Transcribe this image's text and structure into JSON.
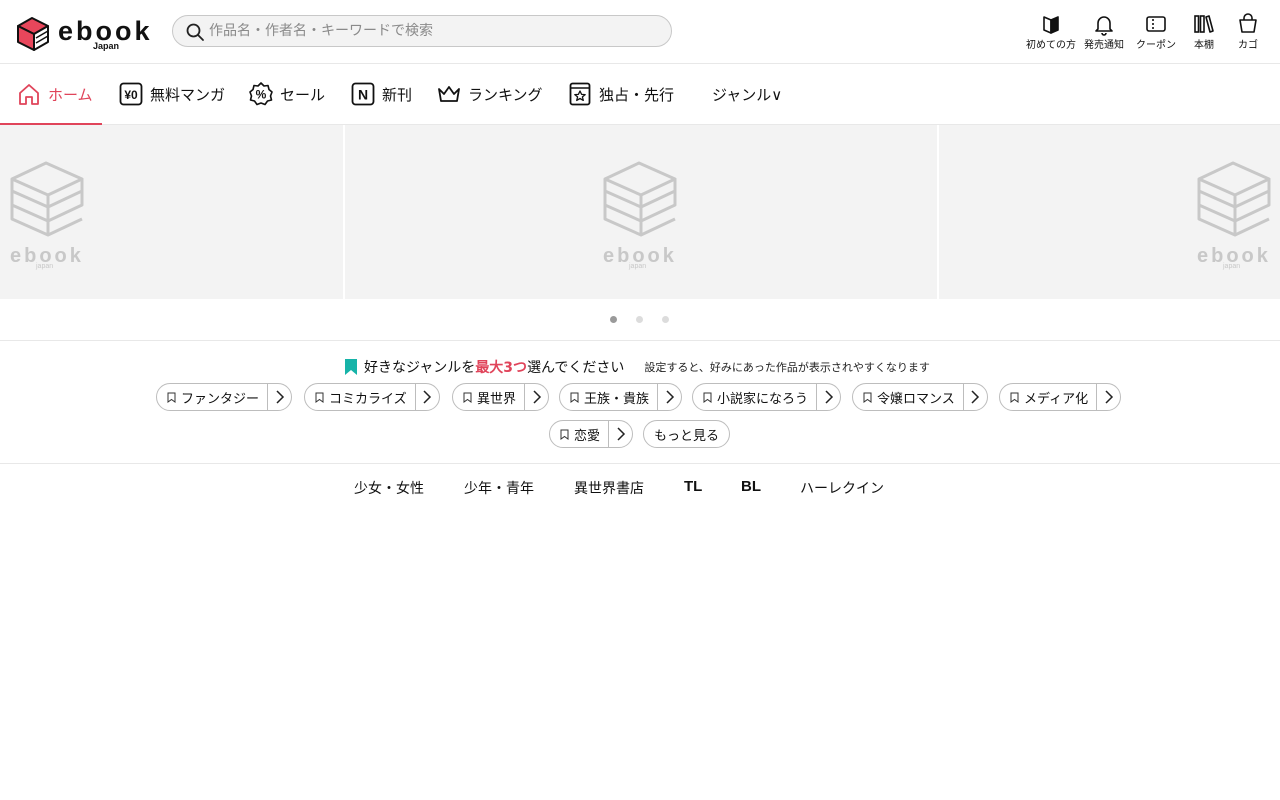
{
  "header": {
    "logo": {
      "word": "ebook",
      "sub": "Japan"
    },
    "search": {
      "placeholder": "作品名・作者名・キーワードで検索",
      "value": ""
    },
    "actions": [
      {
        "label": "初めての方",
        "icon": "beginner-mark-icon"
      },
      {
        "label": "発売通知",
        "icon": "bell-icon"
      },
      {
        "label": "クーポン",
        "icon": "coupon-icon"
      },
      {
        "label": "本棚",
        "icon": "bookshelf-icon"
      },
      {
        "label": "カゴ",
        "icon": "cart-icon"
      }
    ]
  },
  "nav": {
    "tabs": [
      {
        "label": "ホーム",
        "icon": "home-icon",
        "active": true
      },
      {
        "label": "無料マンガ",
        "icon": "yen-zero-icon",
        "active": false
      },
      {
        "label": "セール",
        "icon": "percent-badge-icon",
        "active": false
      },
      {
        "label": "新刊",
        "icon": "new-n-icon",
        "active": false
      },
      {
        "label": "ランキング",
        "icon": "crown-icon",
        "active": false
      },
      {
        "label": "独占・先行",
        "icon": "star-book-icon",
        "active": false
      },
      {
        "label": "ジャンル∨",
        "icon": "",
        "active": false
      }
    ]
  },
  "banner": {
    "slides": [
      {
        "placeholder": "ebook",
        "placeholder_sub": "japan"
      },
      {
        "placeholder": "ebook",
        "placeholder_sub": "japan"
      },
      {
        "placeholder": "ebook",
        "placeholder_sub": "japan"
      }
    ],
    "page_count": 3,
    "current_page": 1
  },
  "genre_prompt": {
    "lead": "好きなジャンルを",
    "highlight": "最大3つ",
    "trail": "選んでください",
    "note": "設定すると、好みにあった作品が表示されやすくなります",
    "chips": [
      "ファンタジー",
      "コミカライズ",
      "異世界",
      "王族・貴族",
      "小説家になろう",
      "令嬢ロマンス",
      "メディア化",
      "恋愛"
    ],
    "more_label": "もっと見る"
  },
  "categories": [
    "少女・女性",
    "少年・青年",
    "異世界書店",
    "TL",
    "BL",
    "ハーレクイン"
  ],
  "colors": {
    "accent": "#e0445a",
    "teal": "#16b3a8",
    "border": "#e8e8e8"
  }
}
